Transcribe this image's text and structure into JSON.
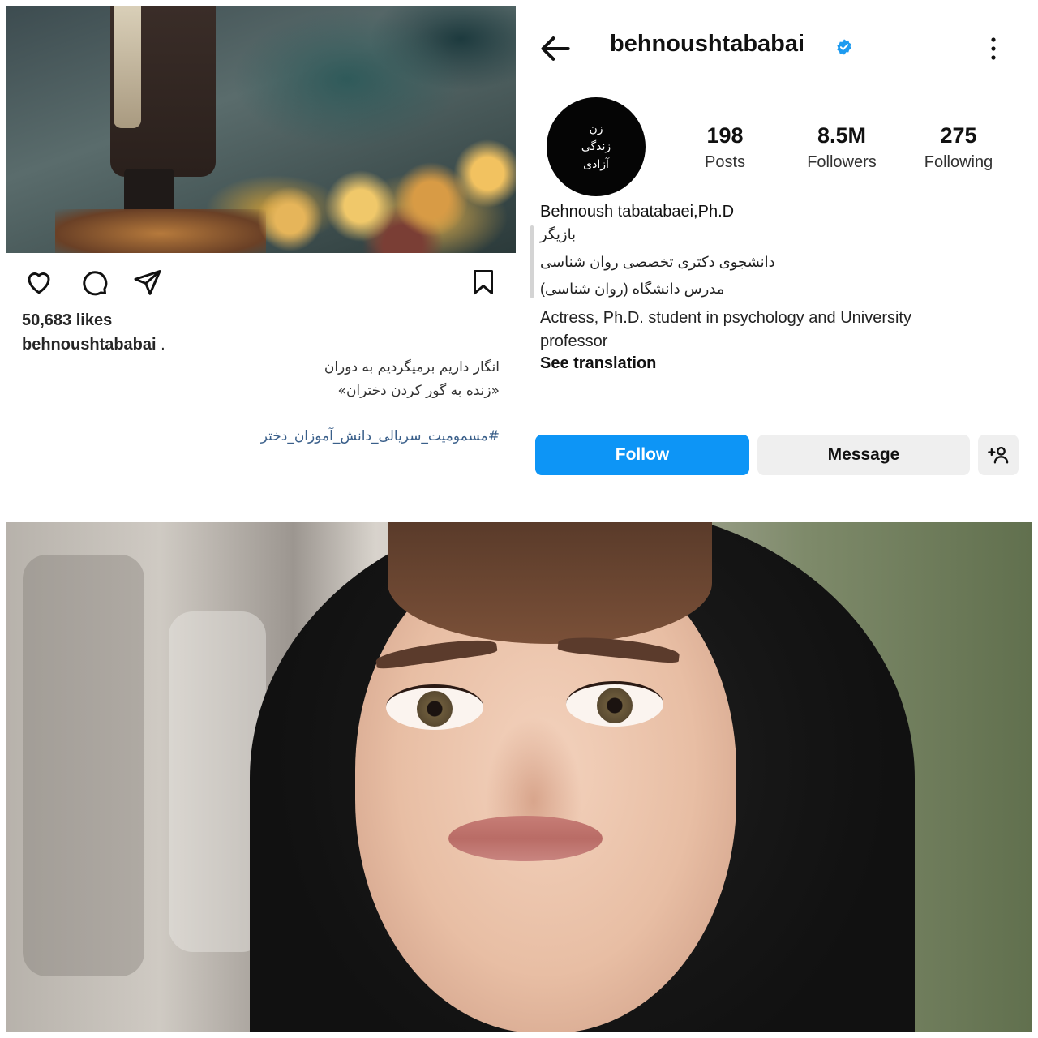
{
  "post": {
    "likes": "50,683 likes",
    "username": "behnoushtababai",
    "username_suffix": " .",
    "caption_line_1": "انگار داریم  برمیگردیم به دوران",
    "caption_line_2": "«زنده به گور کردن دختران»",
    "hashtag": "#مسمومیت_سریالی_دانش_آموزان_دختر",
    "actions": [
      "heart-icon",
      "comment-icon",
      "share-icon",
      "bookmark-icon"
    ]
  },
  "profile": {
    "username": "behnoushtababai",
    "verified": true,
    "avatar_text": [
      "زن",
      "زندگی",
      "آزادی"
    ],
    "stats": {
      "posts_value": "198",
      "posts_label": "Posts",
      "followers_value": "8.5M",
      "followers_label": "Followers",
      "following_value": "275",
      "following_label": "Following"
    },
    "display_name": "Behnoush tabatabaei,Ph.D",
    "bio_fa_1": "بازیگر",
    "bio_fa_2": "دانشجوی دکتری تخصصی روان شناسی",
    "bio_fa_3": "مدرس دانشگاه (روان شناسی)",
    "bio_en": "Actress, Ph.D. student in psychology and University professor",
    "see_translation": "See translation",
    "follow_label": "Follow",
    "message_label": "Message"
  },
  "colors": {
    "follow_blue": "#0d95f6",
    "verified_blue": "#1d9bf0",
    "secondary_button": "#efefef",
    "hashtag": "#3a5f8a"
  }
}
